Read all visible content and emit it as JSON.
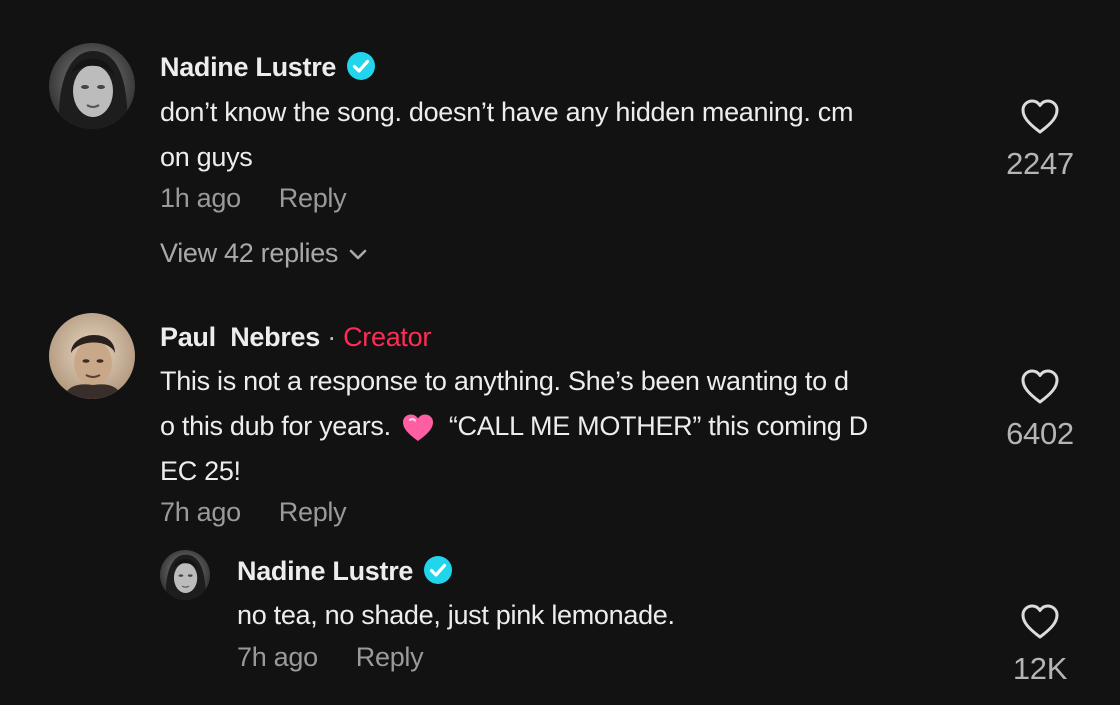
{
  "comments": [
    {
      "author": "Nadine Lustre",
      "verified": true,
      "text_lines": [
        "don’t know the song. doesn’t have any hidden meaning. cm",
        "on guys"
      ],
      "time": "1h ago",
      "reply_label": "Reply",
      "likes": "2247",
      "view_replies": "View 42 replies"
    },
    {
      "author": "Paul  Nebres",
      "separator": "·",
      "creator_label": "Creator",
      "text_lines": [
        "This is not a response to anything. She’s been wanting to d",
        "o this dub for years.",
        "“CALL ME MOTHER” this coming D",
        "EC 25!"
      ],
      "emoji": "pink-heart-icon",
      "time": "7h ago",
      "reply_label": "Reply",
      "likes": "6402"
    }
  ],
  "reply": {
    "author": "Nadine Lustre",
    "verified": true,
    "text": "no tea, no shade, just pink lemonade.",
    "time": "7h ago",
    "reply_label": "Reply",
    "likes": "12K"
  },
  "colors": {
    "background": "#121212",
    "creator": "#fe2c55",
    "verified": "#20d5ec",
    "muted": "#9a9a9a"
  }
}
